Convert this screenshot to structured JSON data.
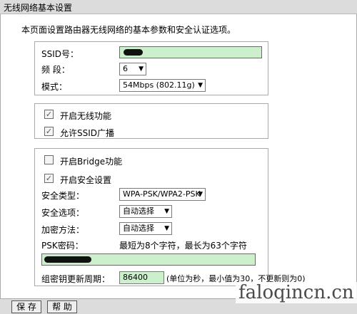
{
  "page_title": "无线网络基本设置",
  "intro_text": "本页面设置路由器无线网络的基本参数和安全认证选项。",
  "basic": {
    "ssid_label": "SSID号：",
    "channel_label": "频 段：",
    "channel_value": "6",
    "mode_label": "模式：",
    "mode_value": "54Mbps (802.11g)"
  },
  "wireless": {
    "enable_label": "开启无线功能",
    "broadcast_label": "允许SSID广播"
  },
  "security": {
    "bridge_label": "开启Bridge功能",
    "security_enable_label": "开启安全设置",
    "type_label": "安全类型：",
    "type_value": "WPA-PSK/WPA2-PSK",
    "option_label": "安全选项：",
    "option_value": "自动选择",
    "encrypt_label": "加密方法：",
    "encrypt_value": "自动选择",
    "psk_label": "PSK密码：",
    "psk_hint": "最短为8个字符，最长为63个字符",
    "rekey_label": "组密钥更新周期：",
    "rekey_value": "86400",
    "rekey_hint": "(单位为秒，最小值为30，不更新则为0)"
  },
  "checkboxes": {
    "enable_wireless": true,
    "allow_broadcast": true,
    "enable_bridge": false,
    "enable_security": true
  },
  "buttons": {
    "save": "保 存",
    "help": "帮 助"
  },
  "watermark": "faloqincn.cn",
  "colors": {
    "field_green": "#ccf0cc",
    "bar_gray": "#dcdcdc"
  }
}
